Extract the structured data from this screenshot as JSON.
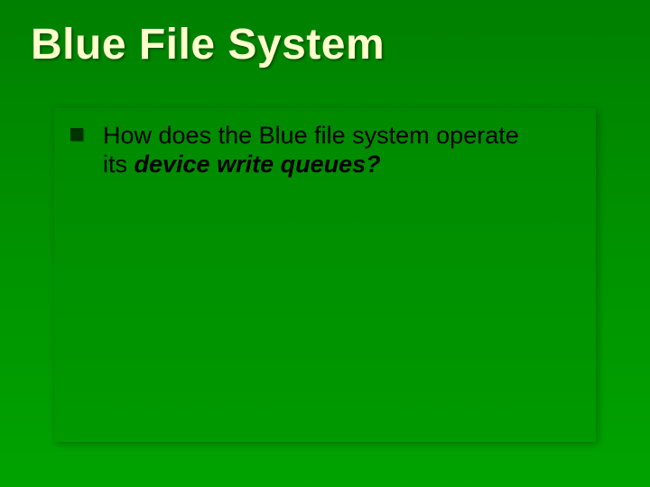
{
  "title": "Blue File System",
  "content": {
    "bullets": [
      {
        "prefix": "How does the Blue file system operate",
        "line2_plain": "its ",
        "line2_emph": "device write queues?"
      }
    ]
  }
}
